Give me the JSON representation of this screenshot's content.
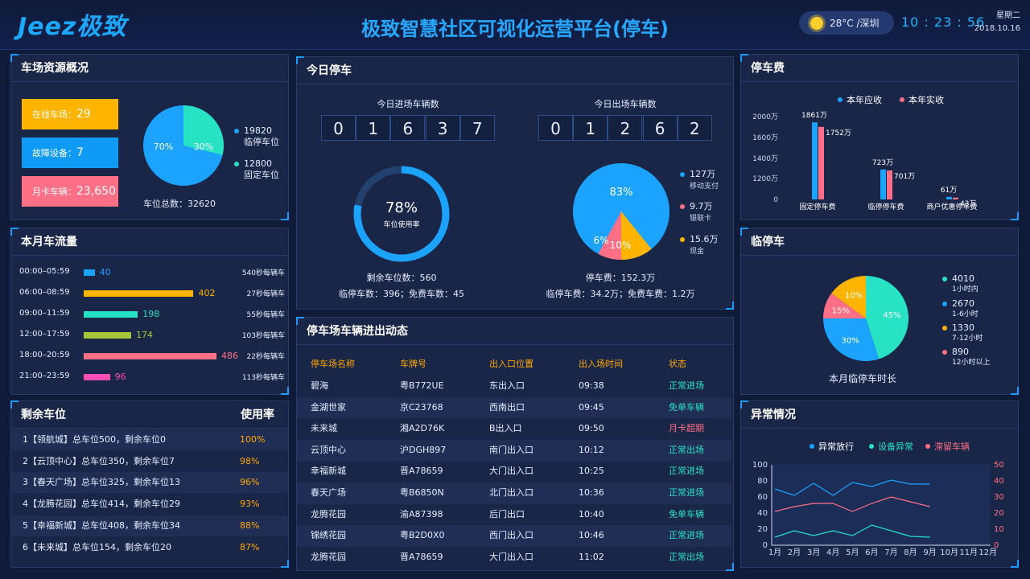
{
  "header": {
    "logo": "Jeez极致",
    "title": "极致智慧社区可视化运营平台(停车)",
    "temperature": "28°C /深圳",
    "time": "10 : 23 : 56",
    "weekday": "星期二",
    "date": "2018.10.16",
    "weather_icon": "sun-icon"
  },
  "resources": {
    "title": "车场资源概况",
    "online_label": "在线车场：",
    "online": "29",
    "fault_label": "故障设备：",
    "fault": "7",
    "monthly_label": "月卡车辆：",
    "monthly": "23,650",
    "pie_pct_a": "70%",
    "pie_pct_b": "30%",
    "legend": [
      {
        "value": "19820",
        "label": "临停车位"
      },
      {
        "value": "12800",
        "label": "固定车位"
      }
    ],
    "total": "车位总数：32620",
    "colors": {
      "online": "#ffb400",
      "fault": "#0f9bf5",
      "monthly": "#ff6f86",
      "pie_a": "#1ba3ff",
      "pie_b": "#28e2c4"
    }
  },
  "flow": {
    "title": "本月车流量",
    "rows": [
      {
        "time": "00:00–05:59",
        "value": 40,
        "rate": "540秒每辆车",
        "color": "#1ba3ff"
      },
      {
        "time": "06:00–08:59",
        "value": 402,
        "rate": "27秒每辆车",
        "color": "#ffb400"
      },
      {
        "time": "09:00–11:59",
        "value": 198,
        "rate": "55秒每辆车",
        "color": "#28e2c4"
      },
      {
        "time": "12:00–17:59",
        "value": 174,
        "rate": "103秒每辆车",
        "color": "#a8c63a"
      },
      {
        "time": "18:00–20:59",
        "value": 486,
        "rate": "22秒每辆车",
        "color": "#ff6f86"
      },
      {
        "time": "21:00–23:59",
        "value": 96,
        "rate": "113秒每辆车",
        "color": "#ff4fb7"
      }
    ]
  },
  "remaining": {
    "title": "剩余车位",
    "rate_header": "使用率",
    "rows": [
      {
        "text": "1【领航城】总车位500，剩余车位0",
        "rate": "100%"
      },
      {
        "text": "2【云顶中心】总车位350，剩余车位7",
        "rate": "98%"
      },
      {
        "text": "3【春天广场】总车位325，剩余车位13",
        "rate": "96%"
      },
      {
        "text": "4【龙腾花园】总车位414，剩余车位29",
        "rate": "93%"
      },
      {
        "text": "5【幸福新城】总车位408，剩余车位34",
        "rate": "88%"
      },
      {
        "text": "6【未来城】总车位154，剩余车位20",
        "rate": "87%"
      }
    ]
  },
  "today": {
    "title": "今日停车",
    "in_label": "今日进场车辆数",
    "in_digits": [
      "0",
      "1",
      "6",
      "3",
      "7"
    ],
    "out_label": "今日出场车辆数",
    "out_digits": [
      "0",
      "1",
      "2",
      "6",
      "2"
    ],
    "usage_pct": "78%",
    "usage_ratio": 0.78,
    "usage_label": "车位使用率",
    "remain_text": "剩余车位数：560",
    "temp_free_text": "临停车数：396；免费车数：45",
    "pay_pie": {
      "pcts": [
        "83%",
        "6%",
        "10%"
      ],
      "legend": [
        {
          "value": "127万",
          "label": "移动支付",
          "color": "#1ba3ff"
        },
        {
          "value": "9.7万",
          "label": "银联卡",
          "color": "#ff6f86"
        },
        {
          "value": "15.6万",
          "label": "现金",
          "color": "#ffb400"
        }
      ]
    },
    "fee_text": "停车费：152.3万",
    "fee_detail": "临停车费：34.2万；免费车费：1.2万"
  },
  "dynamics": {
    "title": "停车场车辆进出动态",
    "headers": [
      "停车场名称",
      "车牌号",
      "出入口位置",
      "出入场时间",
      "状态"
    ],
    "rows": [
      [
        "碧海",
        "粤B772UE",
        "东出入口",
        "09:38",
        "正常进场"
      ],
      [
        "金湖世家",
        "京C23768",
        "西南出口",
        "09:45",
        "免单车辆"
      ],
      [
        "未来城",
        "湘A2D76K",
        "B出入口",
        "09:50",
        "月卡超期"
      ],
      [
        "云顶中心",
        "沪DGH897",
        "南门出入口",
        "10:12",
        "正常出场"
      ],
      [
        "幸福新城",
        "晋A78659",
        "大门出入口",
        "10:25",
        "正常进场"
      ],
      [
        "春天广场",
        "粤B6850N",
        "北门出入口",
        "10:36",
        "正常进场"
      ],
      [
        "龙腾花园",
        "渝A87398",
        "后门出口",
        "10:40",
        "免单车辆"
      ],
      [
        "锦绣花园",
        "粤B2D0X0",
        "西门出入口",
        "10:46",
        "正常进场"
      ],
      [
        "龙腾花园",
        "晋A78659",
        "大门出入口",
        "11:02",
        "正常出场"
      ]
    ],
    "status_colors": {
      "正常进场": "#28e2c4",
      "正常出场": "#28e2c4",
      "免单车辆": "#28e2c4",
      "月卡超期": "#ff6f86"
    }
  },
  "fee": {
    "title": "停车费",
    "chart_data": {
      "type": "bar",
      "legend": [
        "本年应收",
        "本年实收"
      ],
      "categories": [
        "固定停车费",
        "临停停车费",
        "商户优惠停车费"
      ],
      "series": [
        {
          "name": "本年应收",
          "values": [
            1861,
            723,
            61
          ],
          "labels": [
            "1861万",
            "723万",
            "61万"
          ],
          "color": "#1ba3ff"
        },
        {
          "name": "本年实收",
          "values": [
            1752,
            701,
            43
          ],
          "labels": [
            "1752万",
            "701万",
            "43万"
          ],
          "color": "#ff6f86"
        }
      ],
      "yticks": [
        "2000万",
        "1600万",
        "1400万",
        "1200万",
        "0"
      ]
    }
  },
  "temp_parking": {
    "title": "临停车",
    "caption": "本月临停车时长",
    "chart_data": {
      "type": "pie",
      "slices": [
        {
          "value": 4010,
          "label": "1小时内",
          "pct": "45%",
          "color": "#28e2c4"
        },
        {
          "value": 2670,
          "label": "1-6小时",
          "pct": "30%",
          "color": "#1ba3ff"
        },
        {
          "value": 1330,
          "label": "7-12小时",
          "pct": "10%",
          "color": "#ffb400"
        },
        {
          "value": 890,
          "label": "12小时以上",
          "pct": "15%",
          "color": "#ff6f86"
        }
      ]
    }
  },
  "abnormal": {
    "title": "异常情况",
    "chart_data": {
      "type": "line",
      "x": [
        "1月",
        "2月",
        "3月",
        "4月",
        "5月",
        "6月",
        "7月",
        "8月",
        "9月",
        "10月",
        "11月",
        "12月"
      ],
      "y_left": [
        0,
        20,
        40,
        60,
        80,
        100
      ],
      "y_right": [
        0,
        10,
        20,
        30,
        40,
        50
      ],
      "series": [
        {
          "name": "异常放行",
          "color": "#1ba3ff",
          "axis": "left",
          "values": [
            70,
            62,
            77,
            62,
            78,
            73,
            81,
            76,
            76
          ]
        },
        {
          "name": "设备异常",
          "color": "#28e2c4",
          "axis": "left",
          "values": [
            10,
            18,
            12,
            18,
            12,
            25,
            18,
            11,
            10
          ]
        },
        {
          "name": "滞留车辆",
          "color": "#ff6f86",
          "axis": "right",
          "values": [
            21,
            24,
            26,
            26,
            21,
            26,
            30,
            27,
            24
          ]
        }
      ]
    }
  }
}
